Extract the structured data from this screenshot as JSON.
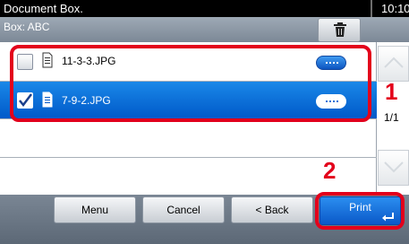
{
  "window": {
    "title": "Document Box.",
    "time": "10:10"
  },
  "header": {
    "box_name": "Box: ABC"
  },
  "files": [
    {
      "name": "11-3-3.JPG",
      "checked": false,
      "selected": false
    },
    {
      "name": "7-9-2.JPG",
      "checked": true,
      "selected": true
    }
  ],
  "pager": {
    "indicator": "1/1"
  },
  "callouts": {
    "step1": "1",
    "step2": "2"
  },
  "buttons": {
    "menu": "Menu",
    "cancel": "Cancel",
    "back": "< Back",
    "print": "Print"
  },
  "colors": {
    "accent": "#e3001b",
    "selection": "#0059c9",
    "titlebar": "#000000"
  },
  "icons": {
    "delete": "trash-icon",
    "file": "document-icon",
    "more": "more-options-icon",
    "enter": "enter-icon"
  }
}
